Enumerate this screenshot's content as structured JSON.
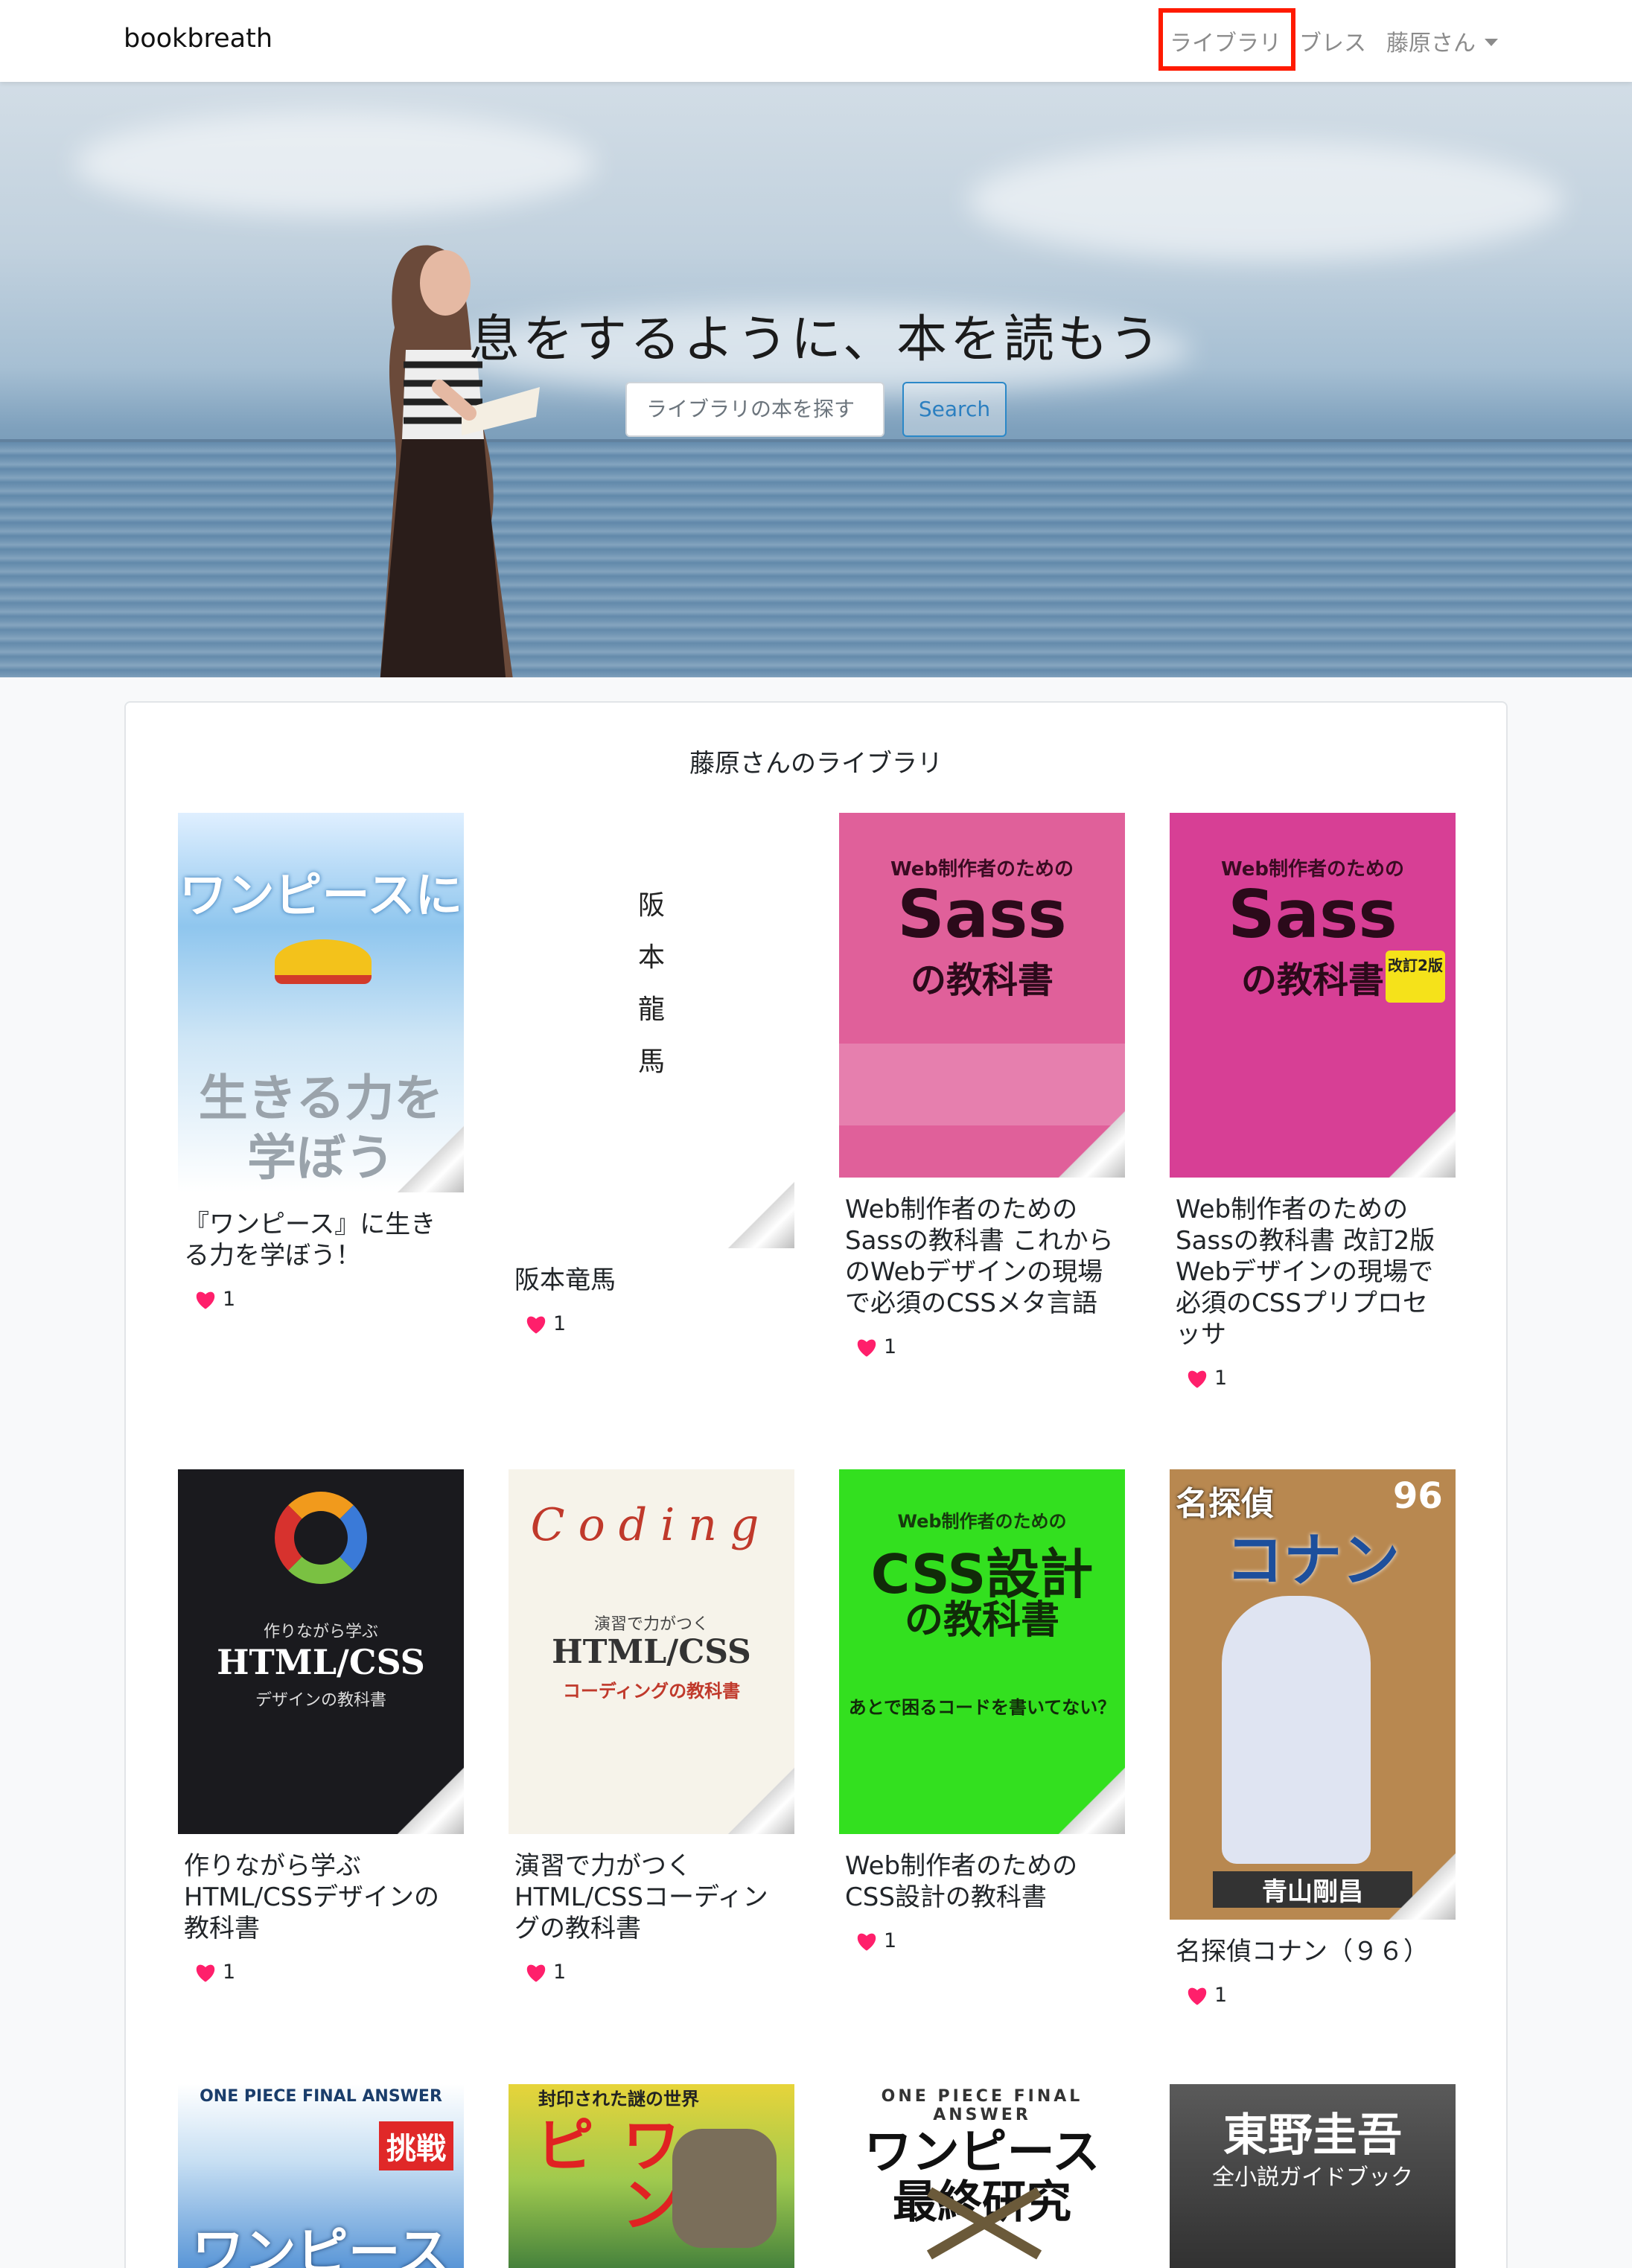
{
  "navbar": {
    "brand": "bookbreath",
    "links": {
      "library": "ライブラリ",
      "breath": "ブレス",
      "user": "藤原さん"
    }
  },
  "hero": {
    "title": "息をするように、本を読もう",
    "search_placeholder": "ライブラリの本を探す",
    "search_button": "Search"
  },
  "library": {
    "title": "藤原さんのライブラリ",
    "books": [
      {
        "title": "『ワンピース』に生きる力を学ぼう！",
        "likes": "1",
        "cover_lines": [
          "ワンピースに",
          "生きる力を",
          "学ぼう"
        ]
      },
      {
        "title": "阪本竜馬",
        "likes": "1",
        "cover_lines": [
          "阪",
          "本",
          "龍",
          "馬"
        ]
      },
      {
        "title": "Web制作者のためのSassの教科書 これからのWebデザインの現場で必須のCSSメタ言語",
        "likes": "1",
        "cover_lines": [
          "Web制作者のための",
          "Sass",
          "の教科書"
        ]
      },
      {
        "title": "Web制作者のためのSassの教科書 改訂2版 Webデザインの現場で必須のCSSプリプロセッサ",
        "likes": "1",
        "cover_lines": [
          "Web制作者のための",
          "Sass",
          "の教科書",
          "改訂2版"
        ]
      },
      {
        "title": "作りながら学ぶHTML/CSSデザインの教科書",
        "likes": "1",
        "cover_lines": [
          "作りながら学ぶ",
          "HTML/CSS",
          "デザインの教科書"
        ]
      },
      {
        "title": "演習で力がつくHTML/CSSコーディングの教科書",
        "likes": "1",
        "cover_lines": [
          "Coding",
          "演習で力がつく",
          "HTML/CSS",
          "コーディングの教科書"
        ]
      },
      {
        "title": "Web制作者のためのCSS設計の教科書",
        "likes": "1",
        "cover_lines": [
          "Web制作者のための",
          "CSS設計",
          "の教科書",
          "あとで困るコードを書いてない？"
        ]
      },
      {
        "title": "名探偵コナン（９６）",
        "likes": "1",
        "cover_lines": [
          "名探偵",
          "コナン",
          "96",
          "青山剛昌"
        ]
      },
      {
        "title": "",
        "likes": "",
        "cover_lines": [
          "ONE PIECE FINAL ANSWER",
          "挑戦",
          "ワンピース"
        ]
      },
      {
        "title": "",
        "likes": "",
        "cover_lines": [
          "ワンピ",
          "封印された謎の世界"
        ]
      },
      {
        "title": "",
        "likes": "",
        "cover_lines": [
          "ONE PIECE FINAL ANSWER",
          "ワンピース",
          "最終研究"
        ]
      },
      {
        "title": "",
        "likes": "",
        "cover_lines": [
          "東野圭吾",
          "全小説ガイドブック"
        ]
      }
    ]
  },
  "colors": {
    "heart": "#ff1f6b",
    "highlight": "#ff1a00",
    "search_button": "#2b7fc0"
  }
}
